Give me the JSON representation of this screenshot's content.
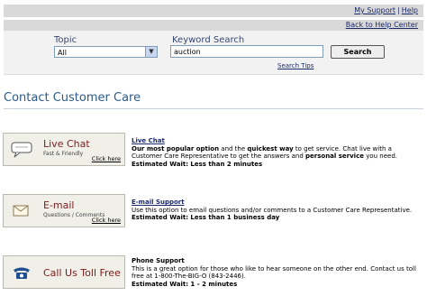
{
  "topnav": {
    "my_support": "My Support",
    "separator": "|",
    "help": "Help"
  },
  "subnav": {
    "back_link": "Back to Help Center"
  },
  "search": {
    "topic_label": "Topic",
    "topic_value": "All",
    "keyword_label": "Keyword Search",
    "keyword_value": "auction",
    "button_label": "Search",
    "tips_link": "Search Tips"
  },
  "page_title": "Contact Customer Care",
  "options": [
    {
      "card_title": "Live Chat",
      "card_subtitle": "Fast & Friendly",
      "icon": "chat-bubble-icon",
      "click_label": "Click here",
      "heading": "Live Chat",
      "desc_1a": "Our most popular option",
      "desc_1b": " and the ",
      "desc_1c": "quickest way",
      "desc_1d": " to get service. Chat live with a Customer Care Representative to get the answers and ",
      "desc_1e": "personal service",
      "desc_1f": " you need.",
      "wait": "Estimated Wait: Less than 2 minutes"
    },
    {
      "card_title": "E-mail",
      "card_subtitle": "Questions / Comments",
      "icon": "envelope-icon",
      "click_label": "Click here",
      "heading": "E-mail Support",
      "desc": "Use this option to email questions and/or comments to a Customer Care Representative.",
      "wait": "Estimated Wait: Less than 1 business day"
    },
    {
      "card_title": "Call Us Toll Free",
      "icon": "telephone-icon",
      "heading": "Phone Support",
      "desc": "This is a great option for those who like to hear someone on the other end. Contact us toll free at 1-800-The-BIG-O (843-2446).",
      "wait": "Estimated Wait: 1 - 2 minutes"
    }
  ]
}
